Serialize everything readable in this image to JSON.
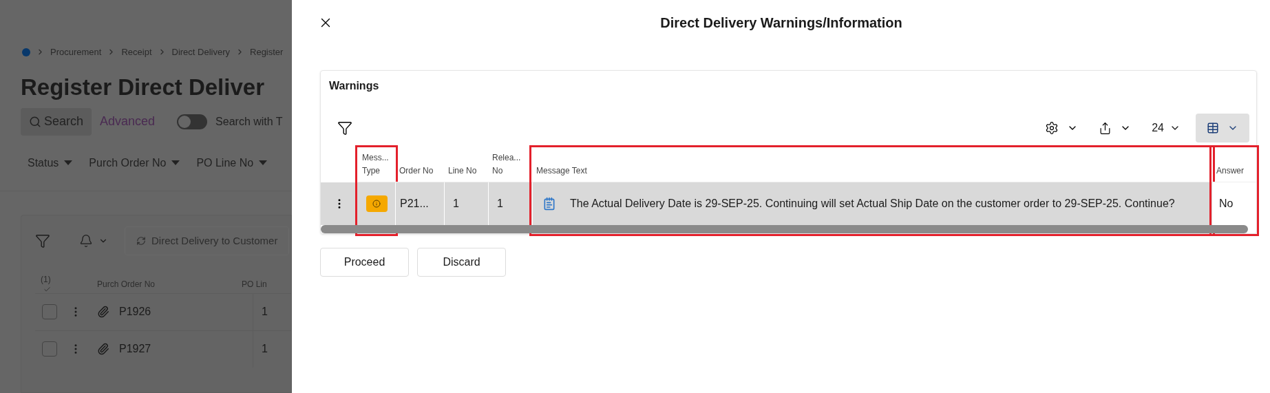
{
  "background_page": {
    "breadcrumb": [
      "Procurement",
      "Receipt",
      "Direct Delivery",
      "Register"
    ],
    "title": "Register Direct Deliver",
    "search": {
      "label": "Search",
      "advanced": "Advanced",
      "toggle": {
        "on": false,
        "label": "Search with T"
      }
    },
    "filters": [
      "Status",
      "Purch Order No",
      "PO Line No"
    ],
    "toolbar": {
      "action": "Direct Delivery to Customer"
    },
    "table": {
      "selection_count": "(1)",
      "columns": [
        "Purch Order No",
        "PO Lin"
      ],
      "rows": [
        {
          "checked": false,
          "order_no": "P1926",
          "po_line": "1"
        },
        {
          "checked": false,
          "order_no": "P1927",
          "po_line": "1"
        }
      ]
    }
  },
  "dialog": {
    "title": "Direct Delivery Warnings/Information",
    "section_title": "Warnings",
    "page_size": "24",
    "columns": [
      {
        "label": "Mess... Type",
        "highlighted": true
      },
      {
        "label": "Order No",
        "highlighted": false
      },
      {
        "label": "Line No",
        "highlighted": false
      },
      {
        "label": "Relea... No",
        "highlighted": false
      },
      {
        "label": "Message Text",
        "highlighted": true
      },
      {
        "label": "Answer",
        "highlighted": true
      }
    ],
    "rows": [
      {
        "selected": true,
        "color": "#f5a800",
        "order_no": "P21...",
        "line_no": "1",
        "release_no": "1",
        "message_text": "The Actual Delivery Date is 29-SEP-25. Continuing will set Actual Ship Date on the customer order to 29-SEP-25. Continue?",
        "answer": "No"
      }
    ],
    "buttons": [
      "Proceed",
      "Discard"
    ]
  }
}
